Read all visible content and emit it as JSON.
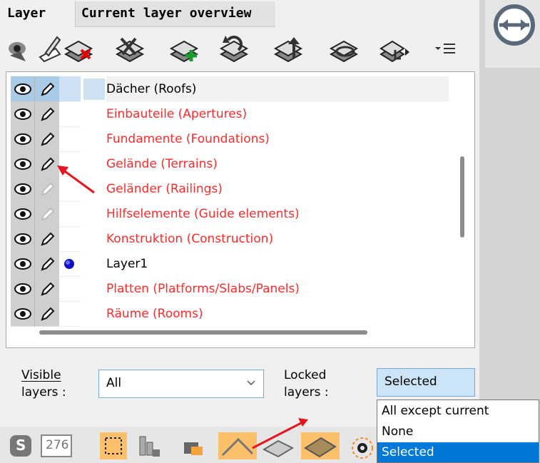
{
  "tabs": [
    {
      "label": "Layer"
    },
    {
      "label": "Current layer overview"
    }
  ],
  "toolbar": {
    "icons": [
      "show-all-layers-icon",
      "edit-layer-icon",
      "delete-layer-icon",
      "layer-tools-icon",
      "new-layer-icon",
      "undo-layer-icon",
      "layer-up-icon",
      "layer-rotate-icon",
      "layer-menu-icon",
      "toolbar-options-icon"
    ]
  },
  "layers": [
    {
      "name": "Dächer (Roofs)",
      "color": "#000000",
      "selected": true,
      "locked_gray": false,
      "current": false
    },
    {
      "name": "Einbauteile (Apertures)",
      "color": "#ff2a2a",
      "selected": false,
      "locked_gray": false,
      "current": false
    },
    {
      "name": "Fundamente (Foundations)",
      "color": "#ff2a2a",
      "selected": false,
      "locked_gray": false,
      "current": false
    },
    {
      "name": "Gelände (Terrains)",
      "color": "#ff2a2a",
      "selected": false,
      "locked_gray": false,
      "current": false
    },
    {
      "name": "Geländer (Railings)",
      "color": "#ff2a2a",
      "selected": false,
      "locked_gray": true,
      "current": false
    },
    {
      "name": "Hilfselemente (Guide elements)",
      "color": "#ff2a2a",
      "selected": false,
      "locked_gray": true,
      "current": false
    },
    {
      "name": "Konstruktion (Construction)",
      "color": "#ff2a2a",
      "selected": false,
      "locked_gray": false,
      "current": false
    },
    {
      "name": "Layer1",
      "color": "#000000",
      "selected": false,
      "locked_gray": false,
      "current": true
    },
    {
      "name": "Platten (Platforms/Slabs/Panels)",
      "color": "#ff2a2a",
      "selected": false,
      "locked_gray": false,
      "current": false
    },
    {
      "name": "Räume (Rooms)",
      "color": "#ff2a2a",
      "selected": false,
      "locked_gray": false,
      "current": false
    }
  ],
  "filters": {
    "visible_label_1": "Visible",
    "visible_label_2": "layers :",
    "visible_value": "All",
    "locked_label_1": "Locked",
    "locked_label_2": "layers :",
    "locked_value": "Selected"
  },
  "dropdown": {
    "options": [
      "All except current",
      "None",
      "Selected"
    ],
    "selected_index": 2
  },
  "bottombar": {
    "s_label": "S",
    "number_label": "276",
    "icons": [
      "s-icon",
      "counter-icon",
      "selection-frame-icon",
      "elements-icon",
      "paint-icon",
      "roof-tool-icon",
      "wall-tool-icon",
      "slab-tool-icon",
      "settings-gear-icon"
    ]
  },
  "colors": {
    "accent": "#0078d7",
    "red_text": "#ff2a2a",
    "annotation_arrow": "#e8141e",
    "highlight": "#fdc06a"
  }
}
